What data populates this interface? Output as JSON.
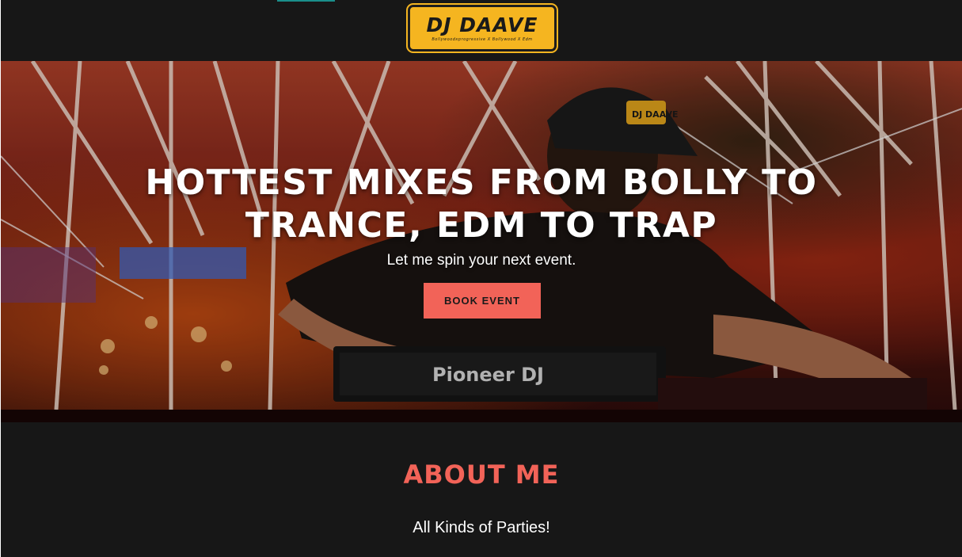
{
  "brand": {
    "logo_title": "DJ DAAVE",
    "logo_tagline": "Bollywoodxprogressive X Bollywood X Edm",
    "colors": {
      "logo_yellow": "#f5b520",
      "accent": "#f26358",
      "background": "#171717",
      "top_accent": "#1a8f8b"
    }
  },
  "hero": {
    "title": "HOTTEST MIXES FROM BOLLY TO TRANCE, EDM TO TRAP",
    "subtitle": "Let me spin your next event.",
    "cta_label": "BOOK EVENT",
    "cap_badge": "DJ DAAVE",
    "console_brand": "Pioneer DJ"
  },
  "about": {
    "title": "ABOUT ME",
    "subtitle": "All Kinds of Parties!"
  }
}
